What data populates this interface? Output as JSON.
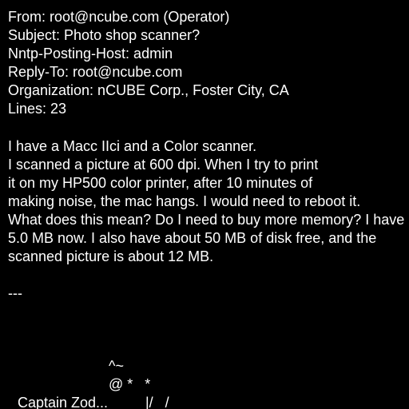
{
  "headers": {
    "from": "From: root@ncube.com (Operator)",
    "subject": "Subject: Photo shop scanner?",
    "nntp_posting_host": "Nntp-Posting-Host: admin",
    "reply_to": "Reply-To: root@ncube.com",
    "organization": "Organization: nCUBE Corp., Foster City, CA",
    "lines": "Lines: 23"
  },
  "body": {
    "lines": [
      "I have a Macc IIci and a Color scanner.",
      "I scanned a picture at 600 dpi. When I try to print",
      "it on my HP500 color printer, after 10 minutes of",
      "making noise, the mac hangs. I would need to reboot it.",
      "What does this mean? Do I need to buy more memory? I have",
      "5.0 MB now. I also have about 50 MB of disk free, and the",
      "scanned picture is about 12 MB."
    ]
  },
  "separator": "---",
  "signature": {
    "art_line_1": "^~",
    "art_line_2": "@ *   *",
    "name": "Captain Zod...",
    "art_line_3": "|/   /"
  },
  "colors": {
    "background": "#000000",
    "text": "#ffffff"
  }
}
